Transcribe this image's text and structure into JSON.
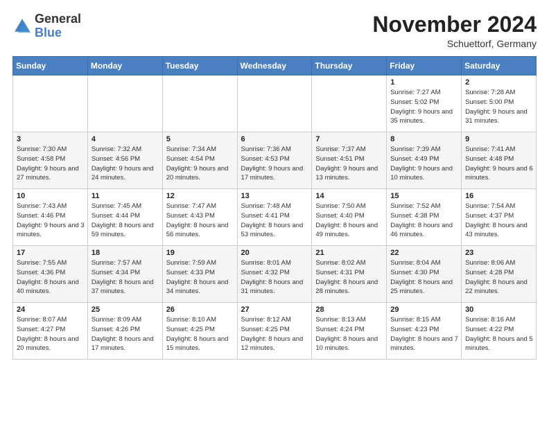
{
  "logo": {
    "general": "General",
    "blue": "Blue"
  },
  "header": {
    "month": "November 2024",
    "location": "Schuettorf, Germany"
  },
  "days_of_week": [
    "Sunday",
    "Monday",
    "Tuesday",
    "Wednesday",
    "Thursday",
    "Friday",
    "Saturday"
  ],
  "weeks": [
    [
      {
        "day": "",
        "info": ""
      },
      {
        "day": "",
        "info": ""
      },
      {
        "day": "",
        "info": ""
      },
      {
        "day": "",
        "info": ""
      },
      {
        "day": "",
        "info": ""
      },
      {
        "day": "1",
        "info": "Sunrise: 7:27 AM\nSunset: 5:02 PM\nDaylight: 9 hours and 35 minutes."
      },
      {
        "day": "2",
        "info": "Sunrise: 7:28 AM\nSunset: 5:00 PM\nDaylight: 9 hours and 31 minutes."
      }
    ],
    [
      {
        "day": "3",
        "info": "Sunrise: 7:30 AM\nSunset: 4:58 PM\nDaylight: 9 hours and 27 minutes."
      },
      {
        "day": "4",
        "info": "Sunrise: 7:32 AM\nSunset: 4:56 PM\nDaylight: 9 hours and 24 minutes."
      },
      {
        "day": "5",
        "info": "Sunrise: 7:34 AM\nSunset: 4:54 PM\nDaylight: 9 hours and 20 minutes."
      },
      {
        "day": "6",
        "info": "Sunrise: 7:36 AM\nSunset: 4:53 PM\nDaylight: 9 hours and 17 minutes."
      },
      {
        "day": "7",
        "info": "Sunrise: 7:37 AM\nSunset: 4:51 PM\nDaylight: 9 hours and 13 minutes."
      },
      {
        "day": "8",
        "info": "Sunrise: 7:39 AM\nSunset: 4:49 PM\nDaylight: 9 hours and 10 minutes."
      },
      {
        "day": "9",
        "info": "Sunrise: 7:41 AM\nSunset: 4:48 PM\nDaylight: 9 hours and 6 minutes."
      }
    ],
    [
      {
        "day": "10",
        "info": "Sunrise: 7:43 AM\nSunset: 4:46 PM\nDaylight: 9 hours and 3 minutes."
      },
      {
        "day": "11",
        "info": "Sunrise: 7:45 AM\nSunset: 4:44 PM\nDaylight: 8 hours and 59 minutes."
      },
      {
        "day": "12",
        "info": "Sunrise: 7:47 AM\nSunset: 4:43 PM\nDaylight: 8 hours and 56 minutes."
      },
      {
        "day": "13",
        "info": "Sunrise: 7:48 AM\nSunset: 4:41 PM\nDaylight: 8 hours and 53 minutes."
      },
      {
        "day": "14",
        "info": "Sunrise: 7:50 AM\nSunset: 4:40 PM\nDaylight: 8 hours and 49 minutes."
      },
      {
        "day": "15",
        "info": "Sunrise: 7:52 AM\nSunset: 4:38 PM\nDaylight: 8 hours and 46 minutes."
      },
      {
        "day": "16",
        "info": "Sunrise: 7:54 AM\nSunset: 4:37 PM\nDaylight: 8 hours and 43 minutes."
      }
    ],
    [
      {
        "day": "17",
        "info": "Sunrise: 7:55 AM\nSunset: 4:36 PM\nDaylight: 8 hours and 40 minutes."
      },
      {
        "day": "18",
        "info": "Sunrise: 7:57 AM\nSunset: 4:34 PM\nDaylight: 8 hours and 37 minutes."
      },
      {
        "day": "19",
        "info": "Sunrise: 7:59 AM\nSunset: 4:33 PM\nDaylight: 8 hours and 34 minutes."
      },
      {
        "day": "20",
        "info": "Sunrise: 8:01 AM\nSunset: 4:32 PM\nDaylight: 8 hours and 31 minutes."
      },
      {
        "day": "21",
        "info": "Sunrise: 8:02 AM\nSunset: 4:31 PM\nDaylight: 8 hours and 28 minutes."
      },
      {
        "day": "22",
        "info": "Sunrise: 8:04 AM\nSunset: 4:30 PM\nDaylight: 8 hours and 25 minutes."
      },
      {
        "day": "23",
        "info": "Sunrise: 8:06 AM\nSunset: 4:28 PM\nDaylight: 8 hours and 22 minutes."
      }
    ],
    [
      {
        "day": "24",
        "info": "Sunrise: 8:07 AM\nSunset: 4:27 PM\nDaylight: 8 hours and 20 minutes."
      },
      {
        "day": "25",
        "info": "Sunrise: 8:09 AM\nSunset: 4:26 PM\nDaylight: 8 hours and 17 minutes."
      },
      {
        "day": "26",
        "info": "Sunrise: 8:10 AM\nSunset: 4:25 PM\nDaylight: 8 hours and 15 minutes."
      },
      {
        "day": "27",
        "info": "Sunrise: 8:12 AM\nSunset: 4:25 PM\nDaylight: 8 hours and 12 minutes."
      },
      {
        "day": "28",
        "info": "Sunrise: 8:13 AM\nSunset: 4:24 PM\nDaylight: 8 hours and 10 minutes."
      },
      {
        "day": "29",
        "info": "Sunrise: 8:15 AM\nSunset: 4:23 PM\nDaylight: 8 hours and 7 minutes."
      },
      {
        "day": "30",
        "info": "Sunrise: 8:16 AM\nSunset: 4:22 PM\nDaylight: 8 hours and 5 minutes."
      }
    ]
  ]
}
